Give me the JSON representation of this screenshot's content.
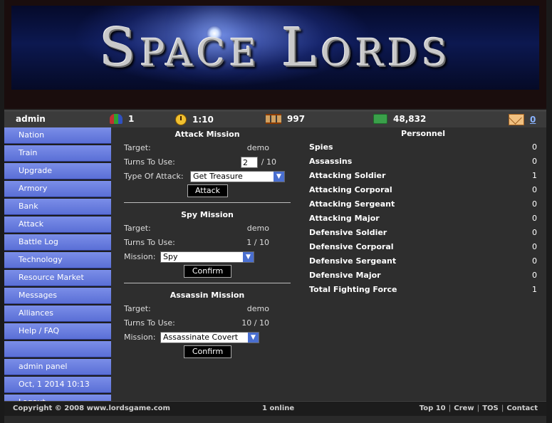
{
  "banner": {
    "title": "Space Lords"
  },
  "status": {
    "username": "admin",
    "population_icon": "people-icon",
    "population": "1",
    "time_icon": "clock-icon",
    "time": "1:10",
    "turns_icon": "hourglass-icon",
    "turns": "997",
    "money_icon": "money-icon",
    "money": "48,832",
    "mail_icon": "mail-icon",
    "mail_count": "0"
  },
  "sidebar": {
    "items": [
      {
        "label": "Nation"
      },
      {
        "label": "Train"
      },
      {
        "label": "Upgrade"
      },
      {
        "label": "Armory"
      },
      {
        "label": "Bank"
      },
      {
        "label": "Attack"
      },
      {
        "label": "Battle Log"
      },
      {
        "label": "Technology"
      },
      {
        "label": "Resource Market"
      },
      {
        "label": "Messages"
      },
      {
        "label": "Alliances"
      },
      {
        "label": "Help / FAQ"
      }
    ],
    "admin_panel": "admin panel",
    "datetime": "Oct, 1 2014 10:13",
    "logout": "Logout"
  },
  "attack": {
    "title": "Attack Mission",
    "target_label": "Target:",
    "target": "demo",
    "turns_label": "Turns To Use:",
    "turns_value": "2",
    "turns_max": "/ 10",
    "type_label": "Type Of Attack:",
    "type_selected": "Get Treasure",
    "button": "Attack"
  },
  "spy": {
    "title": "Spy Mission",
    "target_label": "Target:",
    "target": "demo",
    "turns_label": "Turns To Use:",
    "turns": "1 / 10",
    "mission_label": "Mission:",
    "mission_selected": "Spy",
    "button": "Confirm"
  },
  "assassin": {
    "title": "Assassin Mission",
    "target_label": "Target:",
    "target": "demo",
    "turns_label": "Turns To Use:",
    "turns": "10 / 10",
    "mission_label": "Mission:",
    "mission_selected": "Assassinate Covert",
    "button": "Confirm"
  },
  "personnel": {
    "title": "Personnel",
    "rows": [
      {
        "label": "Spies",
        "value": "0"
      },
      {
        "label": "Assassins",
        "value": "0"
      },
      {
        "label": "Attacking Soldier",
        "value": "1"
      },
      {
        "label": "Attacking Corporal",
        "value": "0"
      },
      {
        "label": "Attacking Sergeant",
        "value": "0"
      },
      {
        "label": "Attacking Major",
        "value": "0"
      },
      {
        "label": "Defensive Soldier",
        "value": "0"
      },
      {
        "label": "Defensive Corporal",
        "value": "0"
      },
      {
        "label": "Defensive Sergeant",
        "value": "0"
      },
      {
        "label": "Defensive Major",
        "value": "0"
      },
      {
        "label": "Total Fighting Force",
        "value": "1"
      }
    ]
  },
  "footer": {
    "copyright": "Copyright © 2008 www.lordsgame.com",
    "online": "1 online",
    "links": {
      "top10": "Top 10",
      "crew": "Crew",
      "tos": "TOS",
      "contact": "Contact"
    }
  }
}
